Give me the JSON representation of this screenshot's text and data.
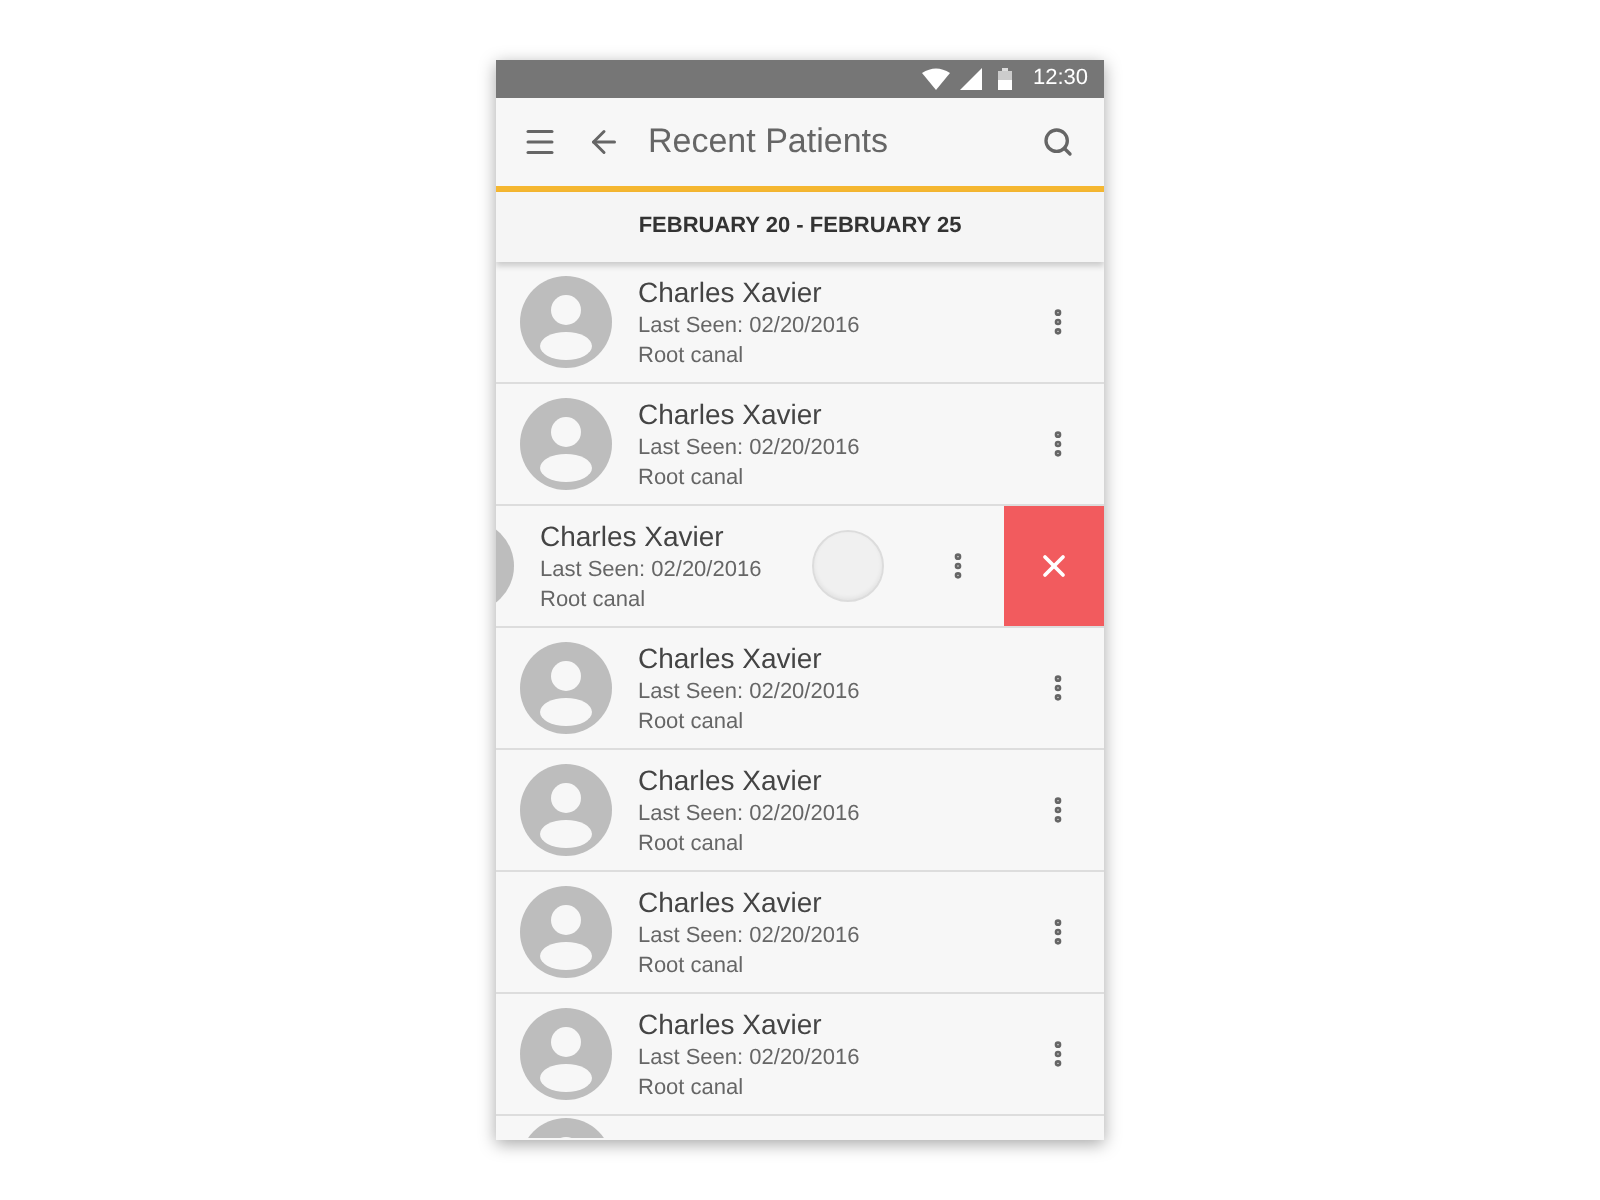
{
  "status_bar": {
    "time": "12:30"
  },
  "app_bar": {
    "title": "Recent Patients"
  },
  "date_header": {
    "label": "FEBRUARY 20 - FEBRUARY 25"
  },
  "patients": [
    {
      "name": "Charles Xavier",
      "last_seen": "Last Seen: 02/20/2016",
      "procedure": "Root canal",
      "swiped": false
    },
    {
      "name": "Charles Xavier",
      "last_seen": "Last Seen: 02/20/2016",
      "procedure": "Root canal",
      "swiped": false
    },
    {
      "name": "Charles Xavier",
      "last_seen": "Last Seen: 02/20/2016",
      "procedure": "Root canal",
      "swiped": true
    },
    {
      "name": "Charles Xavier",
      "last_seen": "Last Seen: 02/20/2016",
      "procedure": "Root canal",
      "swiped": false
    },
    {
      "name": "Charles Xavier",
      "last_seen": "Last Seen: 02/20/2016",
      "procedure": "Root canal",
      "swiped": false
    },
    {
      "name": "Charles Xavier",
      "last_seen": "Last Seen: 02/20/2016",
      "procedure": "Root canal",
      "swiped": false
    },
    {
      "name": "Charles Xavier",
      "last_seen": "Last Seen: 02/20/2016",
      "procedure": "Root canal",
      "swiped": false
    }
  ]
}
